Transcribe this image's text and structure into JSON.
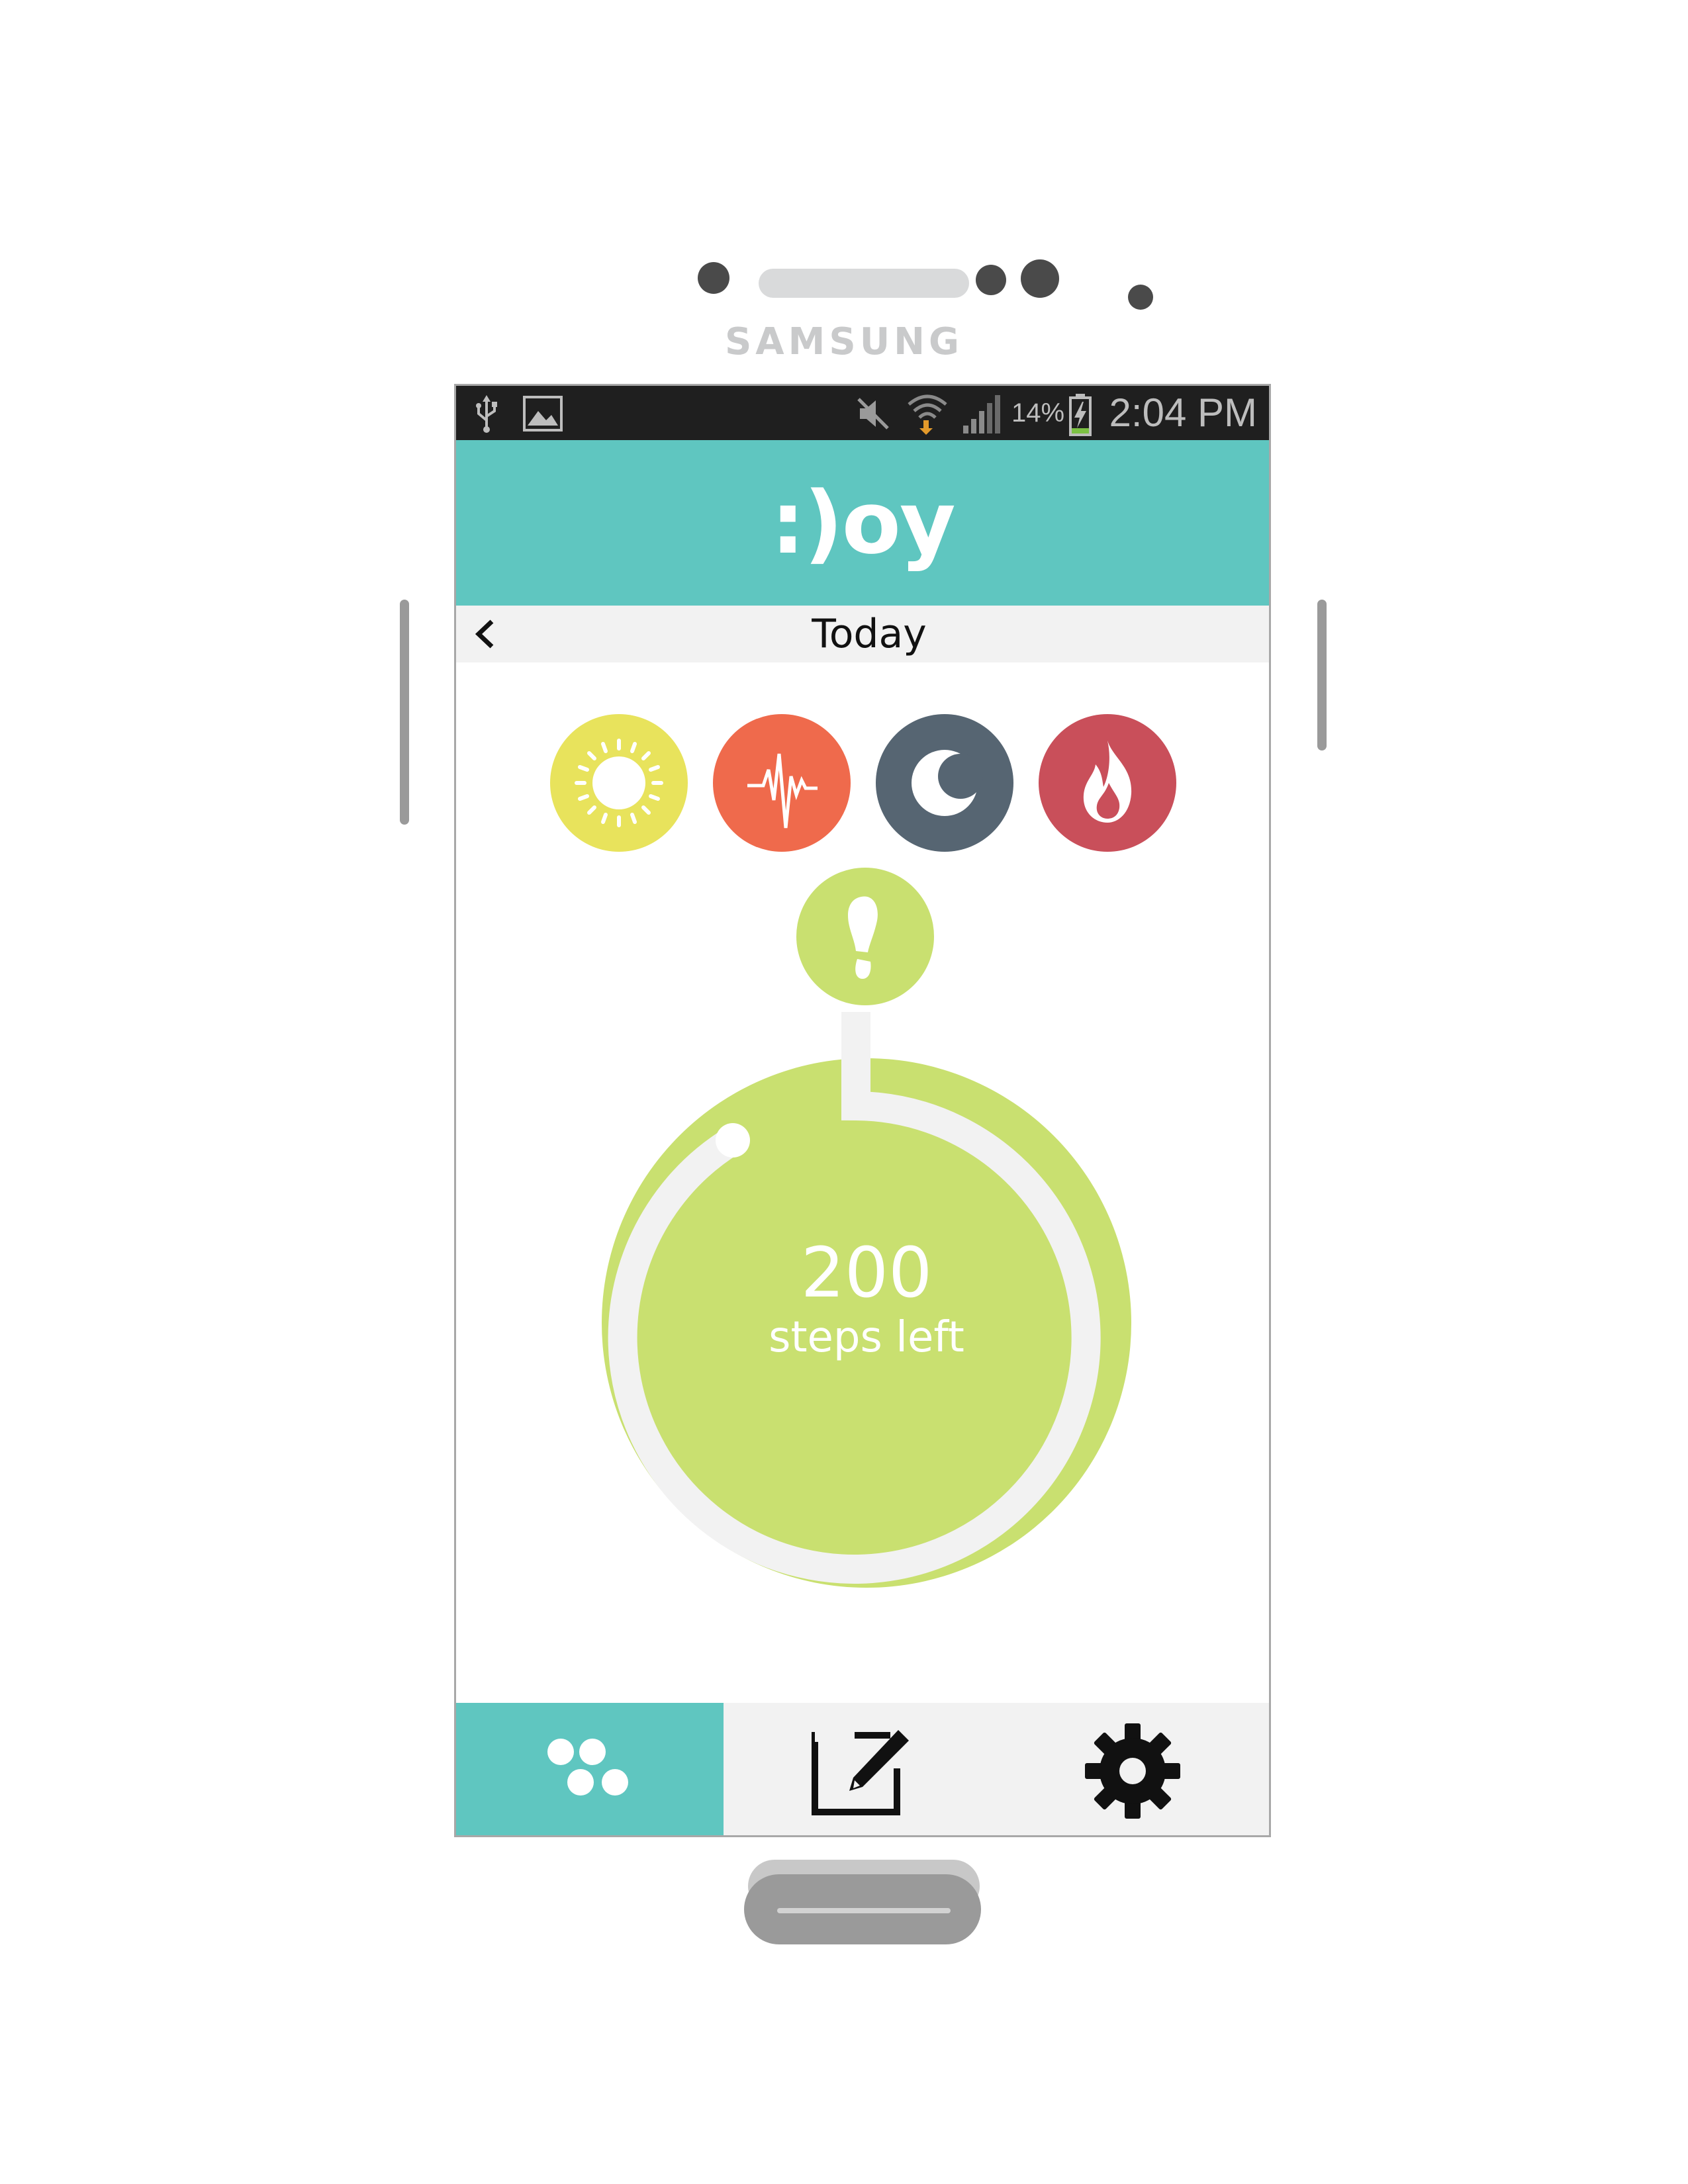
{
  "device": {
    "brand": "SAMSUNG"
  },
  "status_bar": {
    "battery": "14%",
    "time": "2:04 PM"
  },
  "app": {
    "logo": ":)oy"
  },
  "date_nav": {
    "label": "Today"
  },
  "categories": [
    {
      "name": "sun",
      "color": "#e8e35c"
    },
    {
      "name": "activity",
      "color": "#ef6a4c"
    },
    {
      "name": "sleep",
      "color": "#566572"
    },
    {
      "name": "calories",
      "color": "#c94f5a"
    }
  ],
  "steps": {
    "count": "200",
    "label": "steps left",
    "color": "#c9e070"
  },
  "bottom_nav": {
    "tabs": [
      {
        "name": "dashboard",
        "active": true
      },
      {
        "name": "journal",
        "active": false
      },
      {
        "name": "settings",
        "active": false
      }
    ]
  },
  "colors": {
    "teal": "#5fc6c0",
    "light_gray": "#f2f2f2"
  }
}
